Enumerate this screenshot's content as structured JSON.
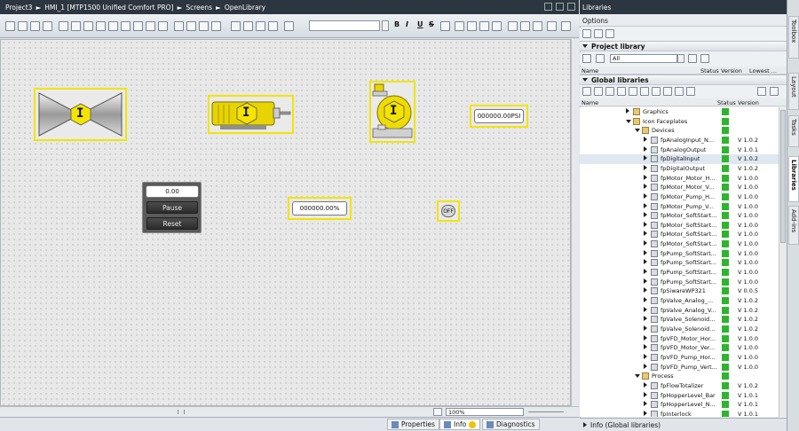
{
  "titlebar": {
    "path": [
      "Project3",
      "HMI_1 [MTP1500 Unified Comfort PRO]",
      "Screens",
      "OpenLibrary"
    ],
    "separator": "►"
  },
  "toolbar": {
    "bold": "B",
    "italic": "I",
    "underline": "U",
    "strike": "S",
    "font_size_value": ""
  },
  "canvas": {
    "faceplate": {
      "value": "0.00",
      "pause": "Pause",
      "reset": "Reset"
    },
    "psi_field": "000000.00PSI",
    "percent_field": "000000.00%",
    "off_button": "OFF",
    "icon_letter": "I"
  },
  "bottom": {
    "zoom": "100%",
    "tabs": {
      "properties": "Properties",
      "info": "Info",
      "diagnostics": "Diagnostics"
    }
  },
  "right_panel": {
    "title": "Libraries",
    "options": "Options",
    "project_library": {
      "title": "Project library",
      "filter": "All",
      "columns": [
        "Name",
        "Status",
        "Version",
        "Lowest ..."
      ]
    },
    "global_libraries": {
      "title": "Global libraries",
      "columns": [
        "Name",
        "Status",
        "Version"
      ]
    },
    "tree": [
      {
        "label": "Graphics",
        "indent": 0,
        "type": "folder",
        "expanded": false,
        "status": true,
        "version": ""
      },
      {
        "label": "Icon Faceplates",
        "indent": 0,
        "type": "folder",
        "expanded": true,
        "status": true,
        "version": ""
      },
      {
        "label": "Devices",
        "indent": 1,
        "type": "folder",
        "expanded": true,
        "status": true,
        "version": ""
      },
      {
        "label": "fpAnalogInput_N...",
        "indent": 2,
        "type": "item",
        "expanded": false,
        "status": true,
        "version": "V 1.0.2"
      },
      {
        "label": "fpAnalogOutput",
        "indent": 2,
        "type": "item",
        "expanded": false,
        "status": true,
        "version": "V 1.0.1"
      },
      {
        "label": "fpDigitalInput",
        "indent": 2,
        "type": "item",
        "expanded": false,
        "status": true,
        "version": "V 1.0.2"
      },
      {
        "label": "fpDigitalOutput",
        "indent": 2,
        "type": "item",
        "expanded": false,
        "status": true,
        "version": "V 1.0.2"
      },
      {
        "label": "fpMotor_Motor_H...",
        "indent": 2,
        "type": "item",
        "expanded": false,
        "status": true,
        "version": "V 1.0.0"
      },
      {
        "label": "fpMotor_Motor_V...",
        "indent": 2,
        "type": "item",
        "expanded": false,
        "status": true,
        "version": "V 1.0.0"
      },
      {
        "label": "fpMotor_Pump_H...",
        "indent": 2,
        "type": "item",
        "expanded": false,
        "status": true,
        "version": "V 1.0.0"
      },
      {
        "label": "fpMotor_Pump_V...",
        "indent": 2,
        "type": "item",
        "expanded": false,
        "status": true,
        "version": "V 1.0.0"
      },
      {
        "label": "fpMotor_SoftStart...",
        "indent": 2,
        "type": "item",
        "expanded": false,
        "status": true,
        "version": "V 1.0.0"
      },
      {
        "label": "fpMotor_SoftStart...",
        "indent": 2,
        "type": "item",
        "expanded": false,
        "status": true,
        "version": "V 1.0.0"
      },
      {
        "label": "fpMotor_SoftStart...",
        "indent": 2,
        "type": "item",
        "expanded": false,
        "status": true,
        "version": "V 1.0.0"
      },
      {
        "label": "fpMotor_SoftStart...",
        "indent": 2,
        "type": "item",
        "expanded": false,
        "status": true,
        "version": "V 1.0.0"
      },
      {
        "label": "fpPump_SoftStart...",
        "indent": 2,
        "type": "item",
        "expanded": false,
        "status": true,
        "version": "V 1.0.0"
      },
      {
        "label": "fpPump_SoftStart...",
        "indent": 2,
        "type": "item",
        "expanded": false,
        "status": true,
        "version": "V 1.0.0"
      },
      {
        "label": "fpPump_SoftStart...",
        "indent": 2,
        "type": "item",
        "expanded": false,
        "status": true,
        "version": "V 1.0.0"
      },
      {
        "label": "fpPump_SoftStart...",
        "indent": 2,
        "type": "item",
        "expanded": false,
        "status": true,
        "version": "V 1.0.0"
      },
      {
        "label": "fpSiwareWP321",
        "indent": 2,
        "type": "item",
        "expanded": false,
        "status": true,
        "version": "V 0.0.5"
      },
      {
        "label": "fpValve_Analog_...",
        "indent": 2,
        "type": "item",
        "expanded": false,
        "status": true,
        "version": "V 1.0.2"
      },
      {
        "label": "fpValve_Analog_V...",
        "indent": 2,
        "type": "item",
        "expanded": false,
        "status": true,
        "version": "V 1.0.2"
      },
      {
        "label": "fpValve_Solenoid...",
        "indent": 2,
        "type": "item",
        "expanded": false,
        "status": true,
        "version": "V 1.0.2"
      },
      {
        "label": "fpValve_Solenoid...",
        "indent": 2,
        "type": "item",
        "expanded": false,
        "status": true,
        "version": "V 1.0.2"
      },
      {
        "label": "fpVFD_Motor_Hor...",
        "indent": 2,
        "type": "item",
        "expanded": false,
        "status": true,
        "version": "V 1.0.0"
      },
      {
        "label": "fpVFD_Motor_Ver...",
        "indent": 2,
        "type": "item",
        "expanded": false,
        "status": true,
        "version": "V 1.0.0"
      },
      {
        "label": "fpVFD_Pump_Hor...",
        "indent": 2,
        "type": "item",
        "expanded": false,
        "status": true,
        "version": "V 1.0.0"
      },
      {
        "label": "fpVFD_Pump_Vert...",
        "indent": 2,
        "type": "item",
        "expanded": false,
        "status": true,
        "version": "V 1.0.0"
      },
      {
        "label": "Process",
        "indent": 1,
        "type": "folder",
        "expanded": true,
        "status": true,
        "version": ""
      },
      {
        "label": "fpFlowTotalizer",
        "indent": 2,
        "type": "item",
        "expanded": false,
        "status": true,
        "version": "V 1.0.2"
      },
      {
        "label": "fpHopperLevel_Bar",
        "indent": 2,
        "type": "item",
        "expanded": false,
        "status": true,
        "version": "V 1.0.1"
      },
      {
        "label": "fpHopperLevel_N...",
        "indent": 2,
        "type": "item",
        "expanded": false,
        "status": true,
        "version": "V 1.0.1"
      },
      {
        "label": "fpInterlock",
        "indent": 2,
        "type": "item",
        "expanded": false,
        "status": true,
        "version": "V 1.0.1"
      }
    ],
    "info_bar": "Info (Global libraries)",
    "side_tabs": [
      "Toolbox",
      "Layout",
      "Tasks",
      "Libraries",
      "Add-ins"
    ]
  },
  "colors": {
    "selection": "#f2e400",
    "icon_yellow": "#f5e400",
    "status_green": "#2db52d",
    "title_dark": "#2c3640"
  }
}
